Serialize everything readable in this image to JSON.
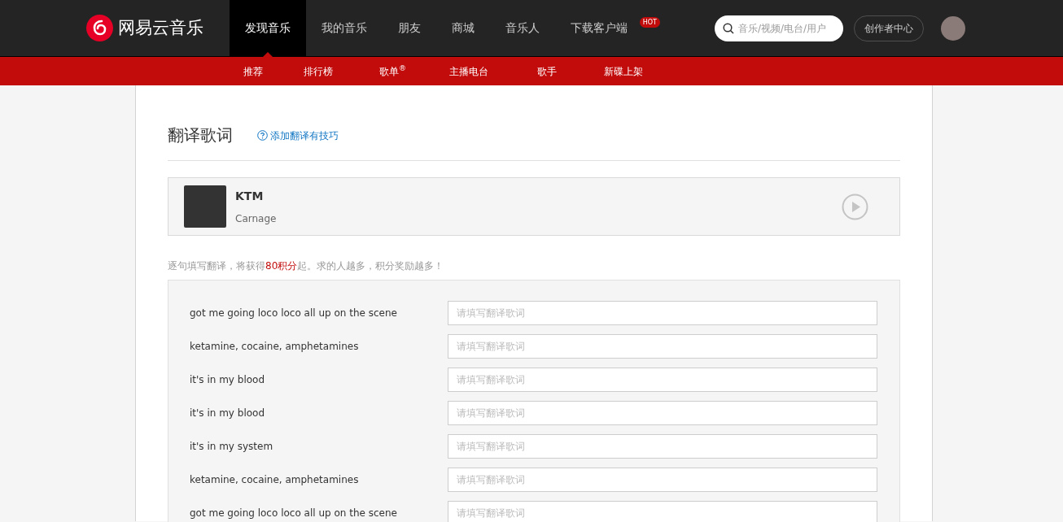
{
  "header": {
    "logo": "网易云音乐",
    "nav": [
      {
        "label": "发现音乐",
        "selected": true
      },
      {
        "label": "我的音乐",
        "selected": false
      },
      {
        "label": "朋友",
        "selected": false
      },
      {
        "label": "商城",
        "selected": false
      },
      {
        "label": "音乐人",
        "selected": false
      },
      {
        "label": "下载客户端",
        "selected": false,
        "badge": "HOT"
      }
    ],
    "search": {
      "placeholder": "音乐/视频/电台/用户"
    },
    "creator_button": "创作者中心"
  },
  "subnav": [
    "推荐",
    "排行榜",
    "歌单$^{®}$",
    "主播电台",
    "歌手",
    "新碟上架"
  ],
  "page": {
    "title": "翻译歌词",
    "help_link": "添加翻译有技巧",
    "song": {
      "title": "KTM",
      "artist": "Carnage"
    },
    "hint": "逐句填写翻译，将获得**80积分**起。求的人越多，积分奖励越多！",
    "lines": [
      {
        "text": "got me going loco loco all up on the scene",
        "placeholder": "请填写翻译歌词"
      },
      {
        "text": "ketamine, cocaine, amphetamines",
        "placeholder": "请填写翻译歌词"
      },
      {
        "text": "it's in my blood",
        "placeholder": "请填写翻译歌词"
      },
      {
        "text": "it's in my blood",
        "placeholder": "请填写翻译歌词"
      },
      {
        "text": "it's in my system",
        "placeholder": "请填写翻译歌词"
      },
      {
        "text": "ketamine, cocaine, amphetamines",
        "placeholder": "请填写翻译歌词"
      },
      {
        "text": "got me going loco loco all up on the scene",
        "placeholder": "请填写翻译歌词"
      }
    ]
  }
}
